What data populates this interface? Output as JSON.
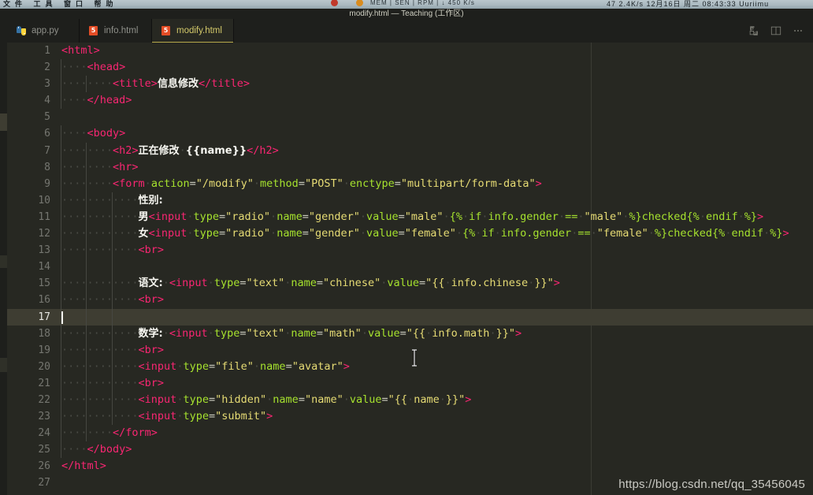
{
  "os_bar": {
    "menu_left": "文件  工具  窗口  帮助",
    "stats": "MEM  |  SEN  |  RPM  |  ↓ 450 K/s",
    "right_status": "47  2.4K/s    12月16日 周二  08:43:33  Uuriimu",
    "colors": {
      "bar_bg": "#a9b8bf",
      "dot_red": "#c0392b",
      "dot_orange": "#d98c1f"
    }
  },
  "window": {
    "title": "modify.html — Teaching (工作区)"
  },
  "tabs": [
    {
      "label": "app.py",
      "icon": "python-icon",
      "active": false
    },
    {
      "label": "info.html",
      "icon": "html5-icon",
      "active": false
    },
    {
      "label": "modify.html",
      "icon": "html5-icon",
      "active": true
    }
  ],
  "tab_actions": [
    {
      "name": "split-editor-icon",
      "label": "Split Editor"
    },
    {
      "name": "toggle-panel-icon",
      "label": "Toggle Panel Layout"
    },
    {
      "name": "more-actions-icon",
      "label": "More Actions..."
    }
  ],
  "editor": {
    "active_line": 17,
    "cursor_column": 1,
    "ruler_column": 80,
    "theme_colors": {
      "background": "#272822",
      "tag": "#f92672",
      "attribute": "#a6e22e",
      "string": "#e6db74",
      "text": "#f8f8f2",
      "line_number": "#8f908a",
      "active_line_bg": "#3e3d32",
      "indent_guide": "#464741"
    },
    "lines": [
      {
        "n": 1,
        "indent": 0,
        "html": "<span class='tag'>&lt;html&gt;</span>"
      },
      {
        "n": 2,
        "indent": 1,
        "html": "<span class='dot'>····</span><span class='tag'>&lt;head&gt;</span>"
      },
      {
        "n": 3,
        "indent": 2,
        "html": "<span class='dot'>····</span><span class='dot'>····</span><span class='tag'>&lt;title&gt;</span><span class='txt'>信息修改</span><span class='tag'>&lt;/title&gt;</span>"
      },
      {
        "n": 4,
        "indent": 1,
        "html": "<span class='dot'>····</span><span class='tag'>&lt;/head&gt;</span>"
      },
      {
        "n": 5,
        "indent": 0,
        "html": ""
      },
      {
        "n": 6,
        "indent": 1,
        "html": "<span class='dot'>····</span><span class='tag'>&lt;body&gt;</span>"
      },
      {
        "n": 7,
        "indent": 2,
        "html": "<span class='dot'>····</span><span class='dot'>····</span><span class='tag'>&lt;h2&gt;</span><span class='txt'>正在修改</span><span class='dot'>·</span><span class='txt'>{{name}}</span><span class='tag'>&lt;/h2&gt;</span>"
      },
      {
        "n": 8,
        "indent": 2,
        "html": "<span class='dot'>····</span><span class='dot'>····</span><span class='tag'>&lt;hr&gt;</span>"
      },
      {
        "n": 9,
        "indent": 2,
        "html": "<span class='dot'>····</span><span class='dot'>····</span><span class='tag'>&lt;form</span><span class='dot'>·</span><span class='attr'>action</span><span class='punc'>=</span><span class='str'>\"/modify\"</span><span class='dot'>·</span><span class='attr'>method</span><span class='punc'>=</span><span class='str'>\"POST\"</span><span class='dot'>·</span><span class='attr'>enctype</span><span class='punc'>=</span><span class='str'>\"multipart/form-data\"</span><span class='tag'>&gt;</span>"
      },
      {
        "n": 10,
        "indent": 3,
        "html": "<span class='dot'>····</span><span class='dot'>····</span><span class='dot'>····</span><span class='txt'>性别:</span>"
      },
      {
        "n": 11,
        "indent": 3,
        "html": "<span class='dot'>····</span><span class='dot'>····</span><span class='dot'>····</span><span class='txt'>男</span><span class='tag'>&lt;input</span><span class='dot'>·</span><span class='attr'>type</span><span class='punc'>=</span><span class='str'>\"radio\"</span><span class='dot'>·</span><span class='attr'>name</span><span class='punc'>=</span><span class='str'>\"gender\"</span><span class='dot'>·</span><span class='attr'>value</span><span class='punc'>=</span><span class='str'>\"male\"</span><span class='dot'>·</span><span class='jin'>{%</span><span class='dot'>·</span><span class='jin'>if</span><span class='dot'>·</span><span class='jin'>info.gender</span><span class='dot'>·</span><span class='jin'>==</span><span class='dot'>·</span><span class='str'>\"male\"</span><span class='dot'>·</span><span class='jin'>%}checked{%</span><span class='dot'>·</span><span class='jin'>endif</span><span class='dot'>·</span><span class='jin'>%}</span><span class='tag'>&gt;</span>"
      },
      {
        "n": 12,
        "indent": 3,
        "html": "<span class='dot'>····</span><span class='dot'>····</span><span class='dot'>····</span><span class='txt'>女</span><span class='tag'>&lt;input</span><span class='dot'>·</span><span class='attr'>type</span><span class='punc'>=</span><span class='str'>\"radio\"</span><span class='dot'>·</span><span class='attr'>name</span><span class='punc'>=</span><span class='str'>\"gender\"</span><span class='dot'>·</span><span class='attr'>value</span><span class='punc'>=</span><span class='str'>\"female\"</span><span class='dot'>·</span><span class='jin'>{%</span><span class='dot'>·</span><span class='jin'>if</span><span class='dot'>·</span><span class='jin'>info.gender</span><span class='dot'>·</span><span class='jin'>==</span><span class='dot'>·</span><span class='str'>\"female\"</span><span class='dot'>·</span><span class='jin'>%}checked{%</span><span class='dot'>·</span><span class='jin'>endif</span><span class='dot'>·</span><span class='jin'>%}</span><span class='tag'>&gt;</span>"
      },
      {
        "n": 13,
        "indent": 3,
        "html": "<span class='dot'>····</span><span class='dot'>····</span><span class='dot'>····</span><span class='tag'>&lt;br&gt;</span>"
      },
      {
        "n": 14,
        "indent": 0,
        "html": ""
      },
      {
        "n": 15,
        "indent": 3,
        "html": "<span class='dot'>····</span><span class='dot'>····</span><span class='dot'>····</span><span class='txt'>语文:</span><span class='dot'>·</span><span class='tag'>&lt;input</span><span class='dot'>·</span><span class='attr'>type</span><span class='punc'>=</span><span class='str'>\"text\"</span><span class='dot'>·</span><span class='attr'>name</span><span class='punc'>=</span><span class='str'>\"chinese\"</span><span class='dot'>·</span><span class='attr'>value</span><span class='punc'>=</span><span class='str'>\"{{</span><span class='dot'>·</span><span class='str'>info.chinese</span><span class='dot'>·</span><span class='str'>}}\"</span><span class='tag'>&gt;</span>"
      },
      {
        "n": 16,
        "indent": 3,
        "html": "<span class='dot'>····</span><span class='dot'>····</span><span class='dot'>····</span><span class='tag'>&lt;br&gt;</span>"
      },
      {
        "n": 17,
        "indent": 0,
        "html": ""
      },
      {
        "n": 18,
        "indent": 3,
        "html": "<span class='dot'>····</span><span class='dot'>····</span><span class='dot'>····</span><span class='txt'>数学:</span><span class='dot'>·</span><span class='tag'>&lt;input</span><span class='dot'>·</span><span class='attr'>type</span><span class='punc'>=</span><span class='str'>\"text\"</span><span class='dot'>·</span><span class='attr'>name</span><span class='punc'>=</span><span class='str'>\"math\"</span><span class='dot'>·</span><span class='attr'>value</span><span class='punc'>=</span><span class='str'>\"{{</span><span class='dot'>·</span><span class='str'>info.math</span><span class='dot'>·</span><span class='str'>}}\"</span><span class='tag'>&gt;</span>"
      },
      {
        "n": 19,
        "indent": 3,
        "html": "<span class='dot'>····</span><span class='dot'>····</span><span class='dot'>····</span><span class='tag'>&lt;br&gt;</span>"
      },
      {
        "n": 20,
        "indent": 3,
        "html": "<span class='dot'>····</span><span class='dot'>····</span><span class='dot'>····</span><span class='tag'>&lt;input</span><span class='dot'>·</span><span class='attr'>type</span><span class='punc'>=</span><span class='str'>\"file\"</span><span class='dot'>·</span><span class='attr'>name</span><span class='punc'>=</span><span class='str'>\"avatar\"</span><span class='tag'>&gt;</span>"
      },
      {
        "n": 21,
        "indent": 3,
        "html": "<span class='dot'>····</span><span class='dot'>····</span><span class='dot'>····</span><span class='tag'>&lt;br&gt;</span>"
      },
      {
        "n": 22,
        "indent": 3,
        "html": "<span class='dot'>····</span><span class='dot'>····</span><span class='dot'>····</span><span class='tag'>&lt;input</span><span class='dot'>·</span><span class='attr'>type</span><span class='punc'>=</span><span class='str'>\"hidden\"</span><span class='dot'>·</span><span class='attr'>name</span><span class='punc'>=</span><span class='str'>\"name\"</span><span class='dot'>·</span><span class='attr'>value</span><span class='punc'>=</span><span class='str'>\"{{</span><span class='dot'>·</span><span class='str'>name</span><span class='dot'>·</span><span class='str'>}}\"</span><span class='tag'>&gt;</span>"
      },
      {
        "n": 23,
        "indent": 3,
        "html": "<span class='dot'>····</span><span class='dot'>····</span><span class='dot'>····</span><span class='tag'>&lt;input</span><span class='dot'>·</span><span class='attr'>type</span><span class='punc'>=</span><span class='str'>\"submit\"</span><span class='tag'>&gt;</span>"
      },
      {
        "n": 24,
        "indent": 2,
        "html": "<span class='dot'>····</span><span class='dot'>····</span><span class='tag'>&lt;/form&gt;</span>"
      },
      {
        "n": 25,
        "indent": 1,
        "html": "<span class='dot'>····</span><span class='tag'>&lt;/body&gt;</span>"
      },
      {
        "n": 26,
        "indent": 0,
        "html": "<span class='tag'>&lt;/html&gt;</span>"
      },
      {
        "n": 27,
        "indent": 0,
        "html": ""
      }
    ]
  },
  "watermark": "https://blog.csdn.net/qq_35456045"
}
